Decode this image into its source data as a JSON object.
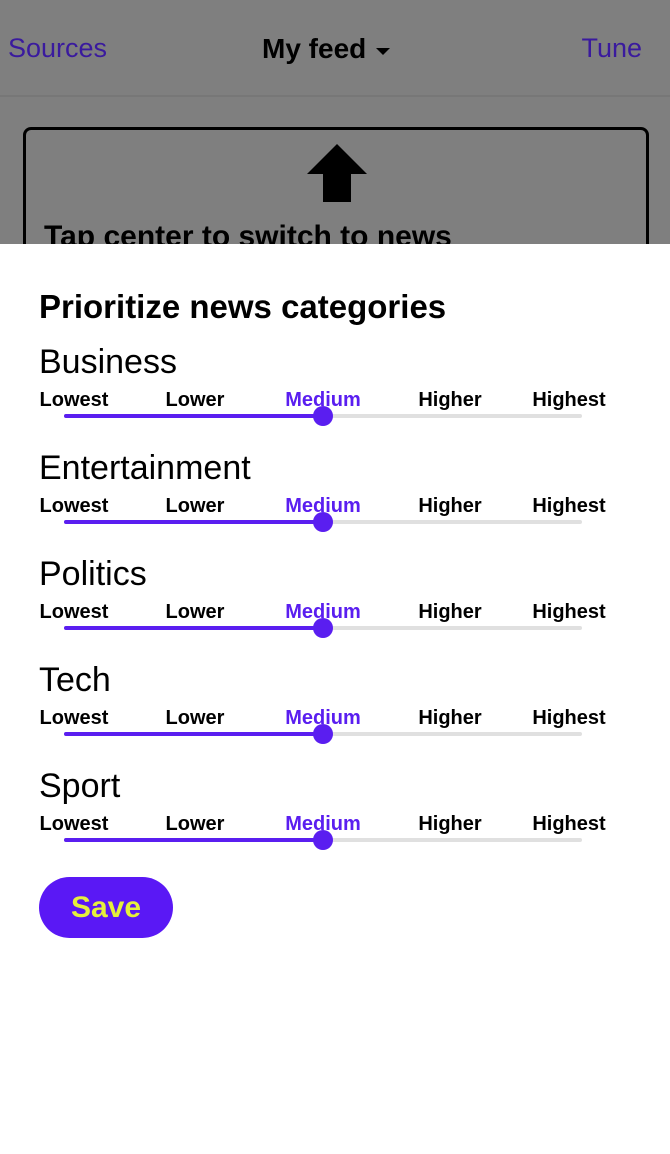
{
  "topbar": {
    "left_link": "Sources",
    "title": "My feed",
    "right_link": "Tune"
  },
  "background_card": {
    "hint_text": "Tap center to switch to news"
  },
  "sheet": {
    "heading": "Prioritize news categories",
    "levels": [
      "Lowest",
      "Lower",
      "Medium",
      "Higher",
      "Highest"
    ],
    "categories": [
      {
        "name": "Business",
        "selected_index": 2,
        "selected_label": "Medium"
      },
      {
        "name": "Entertainment",
        "selected_index": 2,
        "selected_label": "Medium"
      },
      {
        "name": "Politics",
        "selected_index": 2,
        "selected_label": "Medium"
      },
      {
        "name": "Tech",
        "selected_index": 2,
        "selected_label": "Medium"
      },
      {
        "name": "Sport",
        "selected_index": 2,
        "selected_label": "Medium"
      }
    ],
    "save_label": "Save"
  },
  "colors": {
    "accent": "#5a1ef0",
    "save_text": "#e6f03c",
    "link": "#3a1a9e",
    "overlay": "#7f7f7f",
    "track": "#e0e0e0"
  }
}
